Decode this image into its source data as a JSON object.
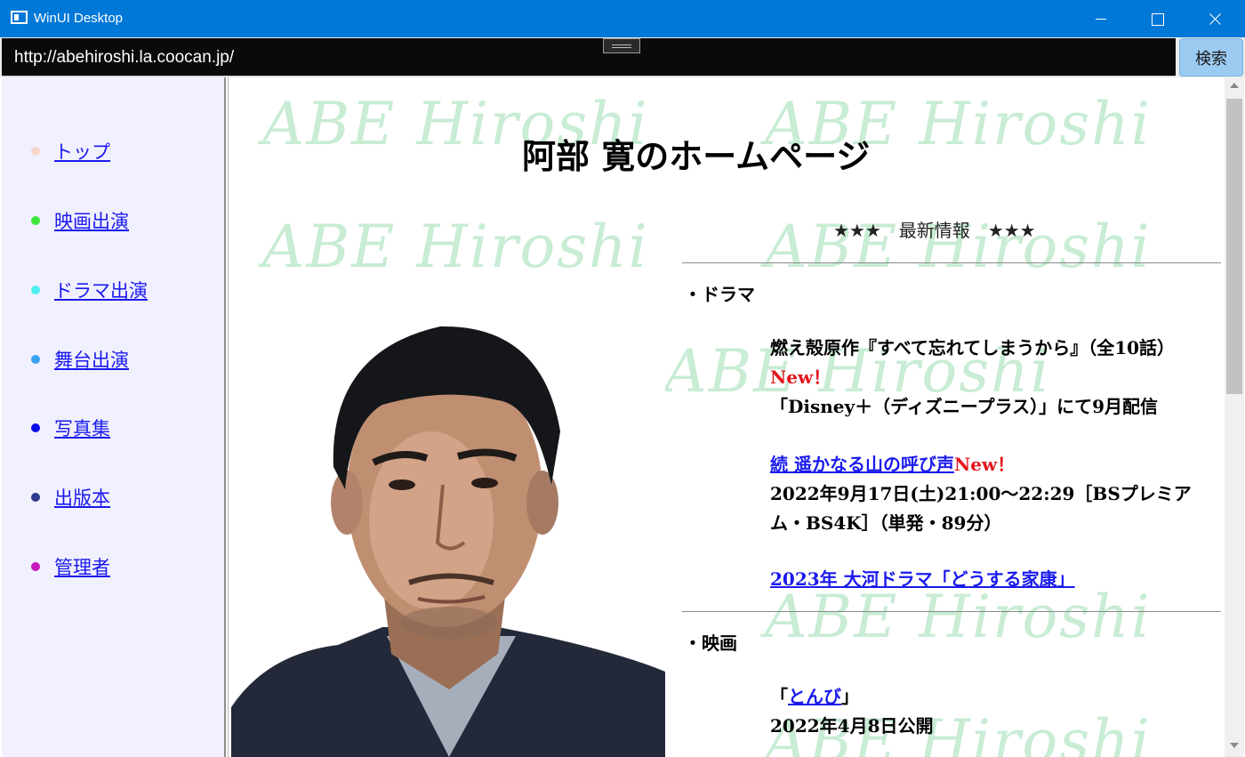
{
  "window": {
    "title": "WinUI Desktop"
  },
  "address_bar": {
    "url": "http://abehiroshi.la.coocan.jp/",
    "search_label": "検索"
  },
  "sidebar": {
    "items": [
      {
        "label": "トップ",
        "dot_color": "#f6d6c8"
      },
      {
        "label": "映画出演",
        "dot_color": "#3ce63c"
      },
      {
        "label": "ドラマ出演",
        "dot_color": "#4ef0f0"
      },
      {
        "label": "舞台出演",
        "dot_color": "#3aa0f0"
      },
      {
        "label": "写真集",
        "dot_color": "#0a0aea"
      },
      {
        "label": "出版本",
        "dot_color": "#2e3a8a"
      },
      {
        "label": "管理者",
        "dot_color": "#c818c0"
      }
    ]
  },
  "page": {
    "watermark": "ABE Hiroshi",
    "title": "阿部 寛のホームページ",
    "news_header": "★★★　最新情報　★★★",
    "drama": {
      "heading": "・ドラマ",
      "item1_line1": "燃え殻原作『すべて忘れてしまうから』（全10話）",
      "item1_new": "New！",
      "item1_line2": "「Disney＋（ディズニープラス）」にて9月配信",
      "item2_link": "続 遥かなる山の呼び声",
      "item2_new": "New！",
      "item2_detail": "2022年9月17日(土)21:00〜22:29［BSプレミアム・BS4K］（単発・89分）",
      "item3_link": "2023年 大河ドラマ「どうする家康」"
    },
    "movie": {
      "heading": "・映画",
      "open_bracket": "「",
      "item1_link": "とんび",
      "close_bracket": "」",
      "item1_date": "2022年4月8日公開"
    }
  },
  "colors": {
    "titlebar": "#0078d7",
    "link": "#1a1aee",
    "new_badge": "#e3161c",
    "sidebar_bg": "#f1f0fe"
  }
}
